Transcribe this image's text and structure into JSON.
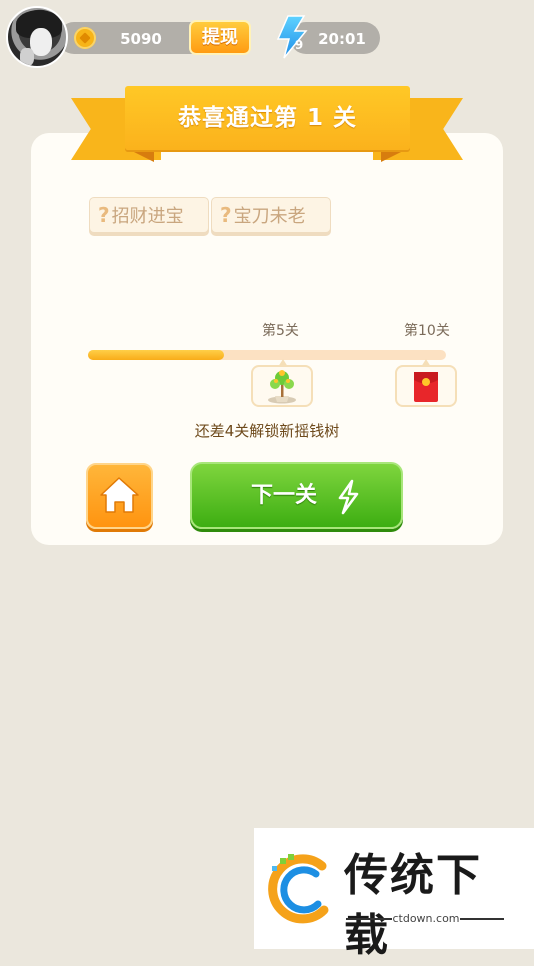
{
  "header": {
    "coins": "5090",
    "withdraw_label": "提现",
    "energy_count": "9",
    "energy_timer": "20:01"
  },
  "banner": {
    "title": "恭喜通过第 1 关"
  },
  "idioms": [
    {
      "mark": "?",
      "text": "招财进宝"
    },
    {
      "mark": "?",
      "text": "宝刀未老"
    }
  ],
  "progress": {
    "milestones": [
      {
        "label": "第5关",
        "reward": "money-tree-icon"
      },
      {
        "label": "第10关",
        "reward": "red-envelope-icon"
      }
    ],
    "fill_fraction": 0.38,
    "hint": "还差4关解锁新摇钱树"
  },
  "buttons": {
    "home": "home-icon",
    "next_label": "下一关"
  },
  "watermark": {
    "brand": "传统下载",
    "url": "ctdown.com"
  },
  "colors": {
    "background": "#ebe7dd",
    "ribbon": "#fbb21c",
    "progress_fill": "#f9ac19",
    "next_button": "#3dae12",
    "home_button": "#ff9410"
  }
}
